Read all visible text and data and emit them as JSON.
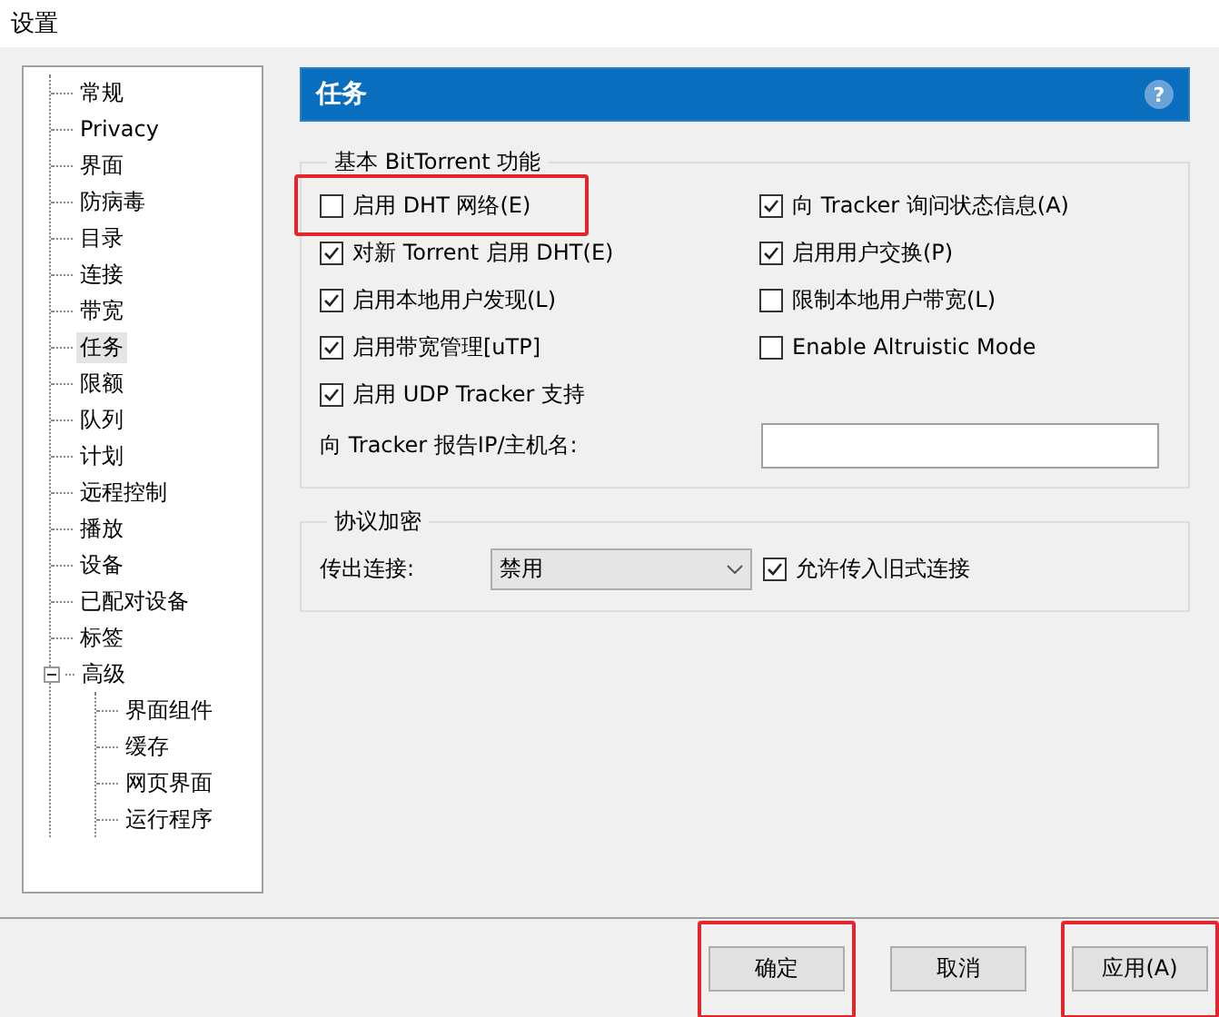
{
  "window": {
    "title": "设置"
  },
  "tree": [
    {
      "label": "常规",
      "selected": false
    },
    {
      "label": "Privacy",
      "selected": false
    },
    {
      "label": "界面",
      "selected": false
    },
    {
      "label": "防病毒",
      "selected": false
    },
    {
      "label": "目录",
      "selected": false
    },
    {
      "label": "连接",
      "selected": false
    },
    {
      "label": "带宽",
      "selected": false
    },
    {
      "label": "任务",
      "selected": true
    },
    {
      "label": "限额",
      "selected": false
    },
    {
      "label": "队列",
      "selected": false
    },
    {
      "label": "计划",
      "selected": false
    },
    {
      "label": "远程控制",
      "selected": false
    },
    {
      "label": "播放",
      "selected": false
    },
    {
      "label": "设备",
      "selected": false
    },
    {
      "label": "已配对设备",
      "selected": false
    },
    {
      "label": "标签",
      "selected": false
    },
    {
      "label": "高级",
      "selected": false,
      "expanded": true,
      "children": [
        {
          "label": "界面组件",
          "selected": false
        },
        {
          "label": "缓存",
          "selected": false
        },
        {
          "label": "网页界面",
          "selected": false
        },
        {
          "label": "运行程序",
          "selected": false
        }
      ]
    }
  ],
  "header": {
    "title": "任务",
    "help": "?"
  },
  "basic_group": {
    "title": "基本 BitTorrent 功能",
    "left_column": [
      {
        "label": "启用 DHT 网络(E)",
        "checked": false,
        "highlighted": true
      },
      {
        "label": "对新 Torrent 启用 DHT(E)",
        "checked": true,
        "highlighted": false
      },
      {
        "label": "启用本地用户发现(L)",
        "checked": true,
        "highlighted": false
      },
      {
        "label": "启用带宽管理[uTP]",
        "checked": true,
        "highlighted": false
      },
      {
        "label": "启用 UDP Tracker 支持",
        "checked": true,
        "highlighted": false
      }
    ],
    "right_column": [
      {
        "label": "向 Tracker 询问状态信息(A)",
        "checked": true,
        "highlighted": false
      },
      {
        "label": "启用用户交换(P)",
        "checked": true,
        "highlighted": false
      },
      {
        "label": "限制本地用户带宽(L)",
        "checked": false,
        "highlighted": false
      },
      {
        "label": "Enable Altruistic Mode",
        "checked": false,
        "highlighted": false
      }
    ],
    "tracker_field": {
      "label": "向 Tracker 报告IP/主机名:"
    }
  },
  "encryption_group": {
    "title": "协议加密",
    "outgoing_label": "传出连接:",
    "outgoing_value": "禁用",
    "legacy": {
      "label": "允许传入旧式连接",
      "checked": true,
      "highlighted": false
    }
  },
  "buttons": [
    {
      "label": "确定",
      "highlighted": true
    },
    {
      "label": "取消",
      "highlighted": false
    },
    {
      "label": "应用(A)",
      "highlighted": true
    }
  ]
}
